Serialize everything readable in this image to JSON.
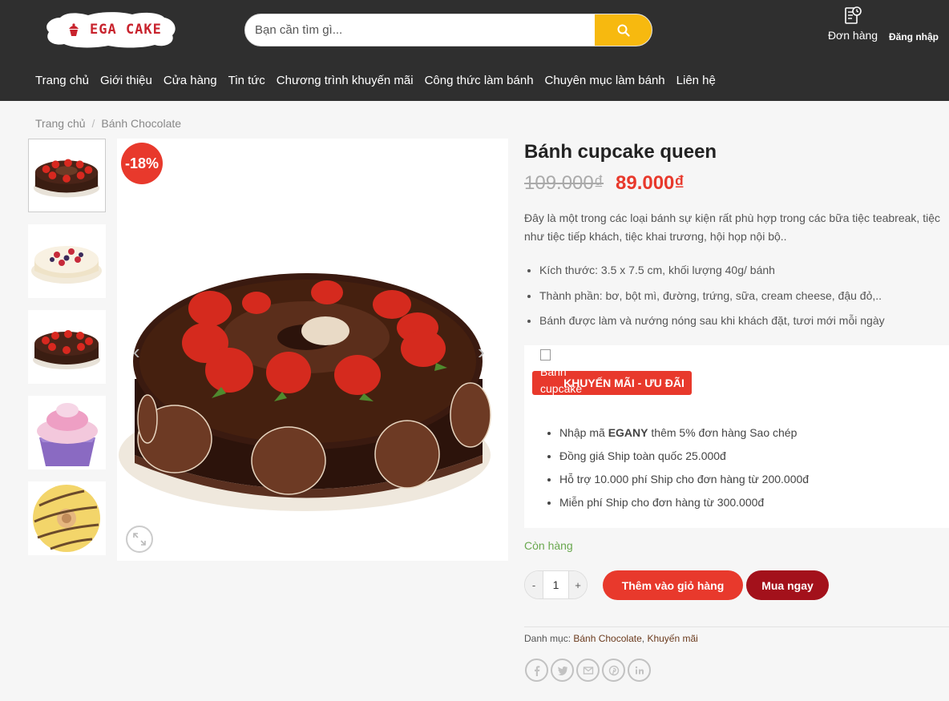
{
  "header": {
    "logo_text": "EGA CAKE",
    "search": {
      "placeholder": "Bạn cần tìm gì..."
    },
    "orders_label": "Đơn hàng",
    "login_label": "Đăng nhập",
    "nav": [
      "Trang chủ",
      "Giới thiệu",
      "Cửa hàng",
      "Tin tức",
      "Chương trình khuyến mãi",
      "Công thức làm bánh",
      "Chuyên mục làm bánh",
      "Liên hệ"
    ]
  },
  "breadcrumb": {
    "home": "Trang chủ",
    "separator": "/",
    "current": "Bánh Chocolate"
  },
  "gallery": {
    "sale_badge": "-18%",
    "thumbnails": [
      "chocolate-strawberry-cake",
      "berry-cream-cake",
      "chocolate-strawberry-cake",
      "pink-cupcake",
      "yellow-donut"
    ],
    "prev_icon": "‹",
    "next_icon": "›"
  },
  "product": {
    "title": "Bánh cupcake queen",
    "old_price": "109.000₫",
    "new_price": "89.000₫",
    "description_line1": "Đây là một trong các loại bánh sự kiện rất phù hợp trong các bữa tiệc teabreak, tiệc",
    "description_line2": "như tiệc tiếp khách, tiệc khai trương, hội họp nội bộ..",
    "features": [
      "Kích thước: 3.5 x 7.5 cm, khối lượng 40g/ bánh",
      "Thành phần: bơ, bột mì, đường, trứng, sữa, cream cheese, đậu đỏ,..",
      "Bánh được làm và nướng nóng sau khi khách đặt, tươi mới mỗi ngày"
    ],
    "promo": {
      "broken_image_alt_1": "Bánh",
      "broken_image_alt_2": "cupcake",
      "badge": "KHUYẾN MÃI - ƯU ĐÃI",
      "code_prefix": "Nhập mã ",
      "code": "EGANY",
      "code_suffix": " thêm 5% đơn hàng Sao chép",
      "items": [
        "Đồng giá Ship toàn quốc 25.000đ",
        "Hỗ trợ 10.000 phí Ship cho đơn hàng từ 200.000đ",
        "Miễn phí Ship cho đơn hàng từ 300.000đ"
      ]
    },
    "stock_status": "Còn hàng",
    "quantity": {
      "minus": "-",
      "value": "1",
      "plus": "+"
    },
    "add_to_cart": "Thêm vào giỏ hàng",
    "buy_now": "Mua ngay",
    "categories_label": "Danh mục: ",
    "categories": [
      "Bánh Chocolate",
      "Khuyến mãi"
    ],
    "category_separator": ", ",
    "share_icons": [
      "facebook-icon",
      "twitter-icon",
      "email-icon",
      "pinterest-icon",
      "linkedin-icon"
    ]
  },
  "colors": {
    "header_bg": "#2f2f2f",
    "search_button": "#f7b90f",
    "accent_red": "#e8392c",
    "buy_now": "#a3111b",
    "in_stock": "#6aa84f",
    "category_link": "#6b3b1e"
  }
}
